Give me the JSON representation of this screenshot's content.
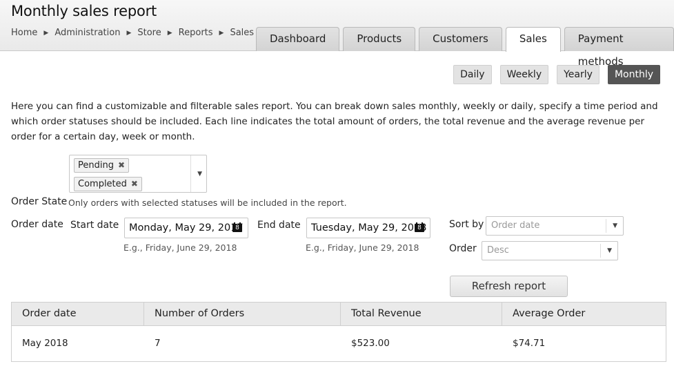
{
  "page": {
    "title": "Monthly sales report"
  },
  "breadcrumb": [
    "Home",
    "Administration",
    "Store",
    "Reports",
    "Sales"
  ],
  "tabs": [
    {
      "label": "Dashboard",
      "active": false
    },
    {
      "label": "Products",
      "active": false
    },
    {
      "label": "Customers",
      "active": false
    },
    {
      "label": "Sales",
      "active": true
    },
    {
      "label": "Payment methods",
      "active": false
    }
  ],
  "period": {
    "options": [
      {
        "label": "Daily",
        "active": false
      },
      {
        "label": "Weekly",
        "active": false
      },
      {
        "label": "Yearly",
        "active": false
      },
      {
        "label": "Monthly",
        "active": true
      }
    ]
  },
  "description": "Here you can find a customizable and filterable sales report. You can break down sales monthly, weekly or daily, specify a time period and which order statuses should be included. Each line indicates the total amount of orders, the total revenue and the average revenue per order for a certain day, week or month.",
  "order_state": {
    "label": "Order State",
    "hint": "Only orders with selected statuses will be included in the report.",
    "selected": [
      "Pending",
      "Completed"
    ]
  },
  "order_date": {
    "label": "Order date",
    "start_label": "Start date",
    "start_value": "Monday, May 29, 2017",
    "start_hint": "E.g., Friday, June 29, 2018",
    "end_label": "End date",
    "end_value": "Tuesday, May 29, 2018",
    "end_hint": "E.g., Friday, June 29, 2018",
    "calendar_icon_text": "8"
  },
  "sort": {
    "sort_by_label": "Sort by",
    "sort_by_placeholder": "Order date",
    "order_label": "Order",
    "order_placeholder": "Desc"
  },
  "refresh_label": "Refresh report",
  "table": {
    "headers": [
      "Order date",
      "Number of Orders",
      "Total Revenue",
      "Average Order"
    ],
    "rows": [
      [
        "May 2018",
        "7",
        "$523.00",
        "$74.71"
      ]
    ]
  },
  "colors": {
    "active_period_bg": "#555555",
    "header_bg": "#e9e9e9",
    "table_header_bg": "#eaeaea"
  }
}
